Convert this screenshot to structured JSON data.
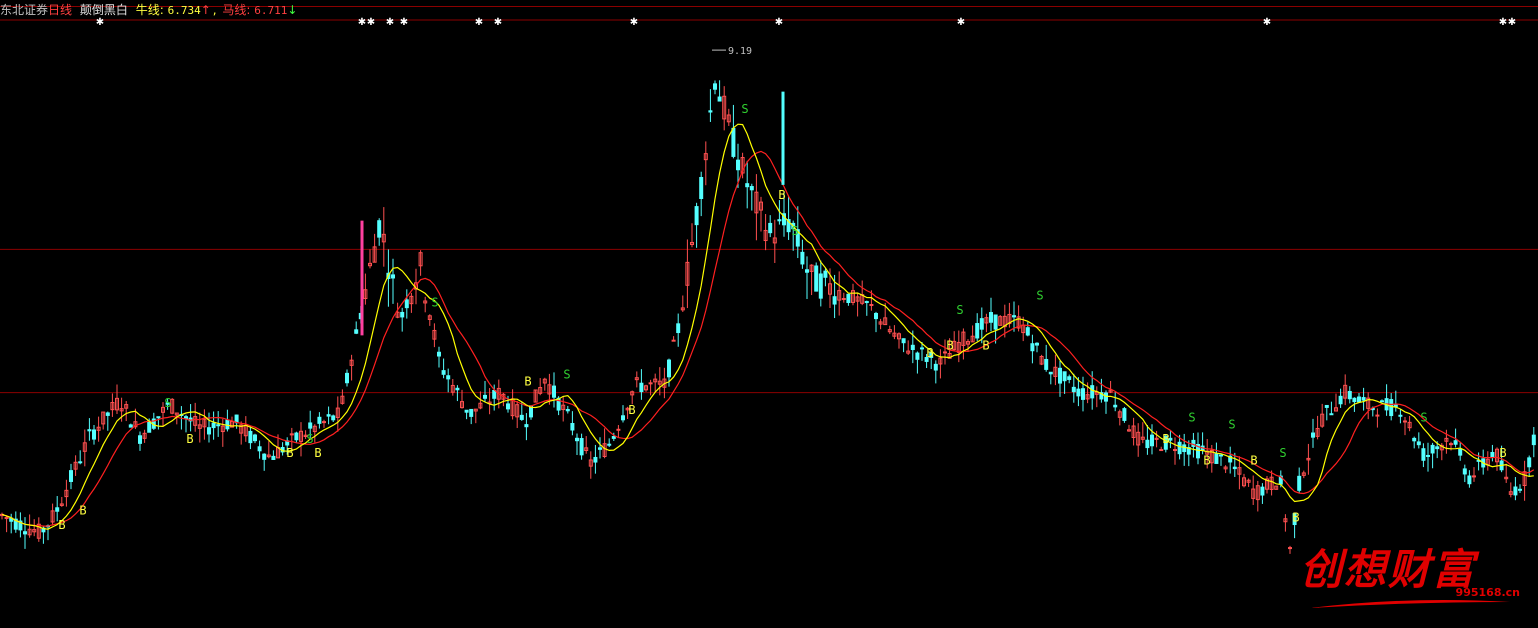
{
  "header": {
    "stock_name": "东北证券",
    "period": "日线",
    "indicator_name": "颠倒黑白",
    "bull_label": "牛线:",
    "bull_value": "6.734",
    "bull_arrow": "↑",
    "horse_label": "马线:",
    "horse_value": "6.711",
    "horse_arrow": "↓"
  },
  "colors": {
    "background": "#000000",
    "up_candle": "#ff5050",
    "down_candle": "#54ffff",
    "bull_line": "#ffff00",
    "horse_line": "#ff2020",
    "buy_marker": "#ffff40",
    "sell_marker": "#30d030",
    "grid": "#8b0000",
    "event_marker": "#ffffff"
  },
  "logo": {
    "name": "创想财富",
    "url": "995168.cn"
  },
  "chart_data": {
    "type": "candlestick",
    "title": "东北证券 日线 颠倒黑白",
    "ylim": [
      5.2,
      9.4
    ],
    "gridlines": [
      7.8,
      6.8
    ],
    "peak_label": "9.19",
    "peak_value": 9.19,
    "last_values": {
      "牛线": 6.734,
      "马线": 6.711
    },
    "series_names": [
      "牛线",
      "马线"
    ],
    "segments": [
      [
        0,
        5.95
      ],
      [
        40,
        5.82
      ],
      [
        55,
        5.95
      ],
      [
        90,
        6.5
      ],
      [
        120,
        6.75
      ],
      [
        140,
        6.5
      ],
      [
        170,
        6.72
      ],
      [
        200,
        6.55
      ],
      [
        235,
        6.6
      ],
      [
        270,
        6.35
      ],
      [
        300,
        6.5
      ],
      [
        340,
        6.65
      ],
      [
        365,
        7.5
      ],
      [
        380,
        8.0
      ],
      [
        400,
        7.3
      ],
      [
        420,
        7.7
      ],
      [
        440,
        7.0
      ],
      [
        470,
        6.65
      ],
      [
        500,
        6.8
      ],
      [
        525,
        6.6
      ],
      [
        545,
        6.9
      ],
      [
        570,
        6.6
      ],
      [
        590,
        6.3
      ],
      [
        610,
        6.45
      ],
      [
        635,
        6.85
      ],
      [
        665,
        6.85
      ],
      [
        680,
        7.3
      ],
      [
        700,
        8.2
      ],
      [
        715,
        9.0
      ],
      [
        735,
        8.5
      ],
      [
        750,
        8.2
      ],
      [
        770,
        7.9
      ],
      [
        790,
        8.0
      ],
      [
        810,
        7.6
      ],
      [
        840,
        7.5
      ],
      [
        870,
        7.4
      ],
      [
        900,
        7.15
      ],
      [
        940,
        7.0
      ],
      [
        960,
        7.15
      ],
      [
        990,
        7.3
      ],
      [
        1020,
        7.3
      ],
      [
        1045,
        7.0
      ],
      [
        1080,
        6.8
      ],
      [
        1110,
        6.8
      ],
      [
        1140,
        6.45
      ],
      [
        1170,
        6.45
      ],
      [
        1200,
        6.4
      ],
      [
        1230,
        6.3
      ],
      [
        1255,
        6.1
      ],
      [
        1280,
        6.2
      ],
      [
        1290,
        5.7
      ],
      [
        1300,
        6.2
      ],
      [
        1320,
        6.6
      ],
      [
        1345,
        6.8
      ],
      [
        1370,
        6.7
      ],
      [
        1400,
        6.7
      ],
      [
        1425,
        6.35
      ],
      [
        1450,
        6.5
      ],
      [
        1470,
        6.2
      ],
      [
        1495,
        6.4
      ],
      [
        1510,
        6.1
      ],
      [
        1525,
        6.2
      ],
      [
        1537,
        6.6
      ]
    ],
    "buy_signals": [
      [
        62,
        5.85
      ],
      [
        83,
        5.95
      ],
      [
        190,
        6.45
      ],
      [
        290,
        6.35
      ],
      [
        318,
        6.35
      ],
      [
        528,
        6.85
      ],
      [
        632,
        6.65
      ],
      [
        782,
        8.15
      ],
      [
        930,
        7.05
      ],
      [
        950,
        7.1
      ],
      [
        986,
        7.1
      ],
      [
        1166,
        6.45
      ],
      [
        1207,
        6.3
      ],
      [
        1254,
        6.3
      ],
      [
        1296,
        5.9
      ],
      [
        1503,
        6.35
      ]
    ],
    "sell_signals": [
      [
        168,
        6.7
      ],
      [
        310,
        6.45
      ],
      [
        435,
        7.4
      ],
      [
        567,
        6.9
      ],
      [
        745,
        8.75
      ],
      [
        795,
        7.9
      ],
      [
        960,
        7.35
      ],
      [
        1040,
        7.45
      ],
      [
        1192,
        6.6
      ],
      [
        1232,
        6.55
      ],
      [
        1283,
        6.35
      ],
      [
        1424,
        6.6
      ]
    ],
    "event_markers_x": [
      100,
      362,
      371,
      390,
      404,
      479,
      498,
      634,
      779,
      961,
      1267,
      1503,
      1512
    ]
  }
}
